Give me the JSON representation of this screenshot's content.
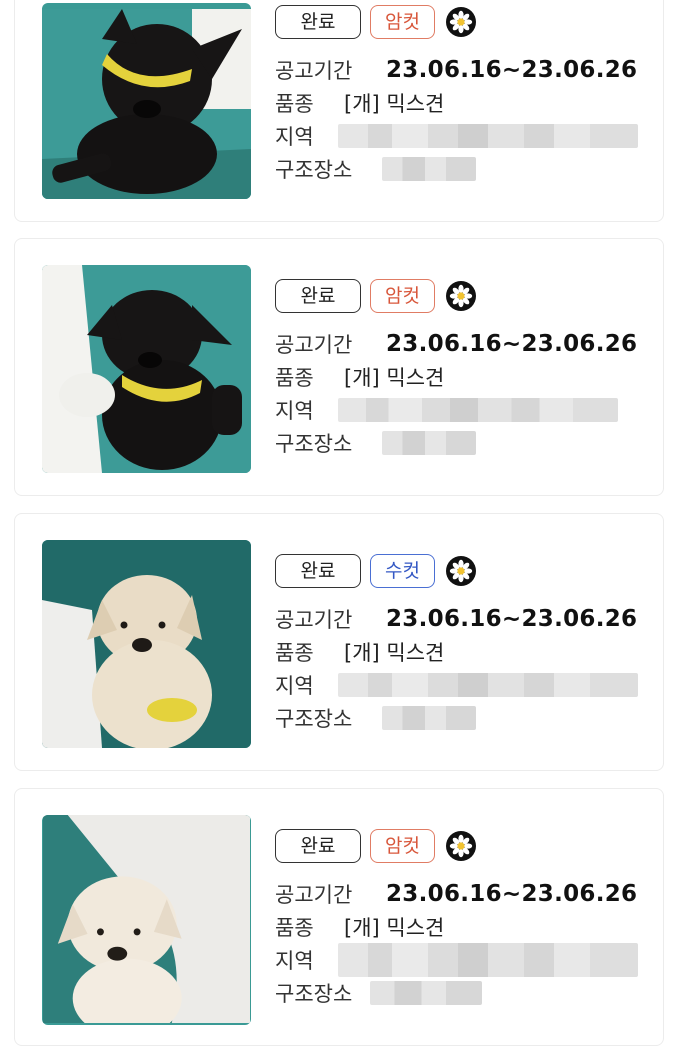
{
  "labels": {
    "period": "공고기간",
    "breed": "품종",
    "region": "지역",
    "shelter": "구조장소"
  },
  "listings": [
    {
      "status": "완료",
      "sex": "암컷",
      "sex_kind": "female",
      "period": "23.06.16~23.06.26",
      "breed": "[개] 믹스견",
      "dog_color": "#161414"
    },
    {
      "status": "완료",
      "sex": "암컷",
      "sex_kind": "female",
      "period": "23.06.16~23.06.26",
      "breed": "[개] 믹스견",
      "dog_color": "#151313"
    },
    {
      "status": "완료",
      "sex": "수컷",
      "sex_kind": "male",
      "period": "23.06.16~23.06.26",
      "breed": "[개] 믹스견",
      "dog_color": "#e9dcc6"
    },
    {
      "status": "완료",
      "sex": "암컷",
      "sex_kind": "female",
      "period": "23.06.16~23.06.26",
      "breed": "[개] 믹스견",
      "dog_color": "#f1e9dc"
    }
  ],
  "colors": {
    "female_tag": "#d8573b",
    "male_tag": "#3458c4",
    "photo_bg": "#3a9a95"
  },
  "icons": [
    "daisy-icon"
  ]
}
